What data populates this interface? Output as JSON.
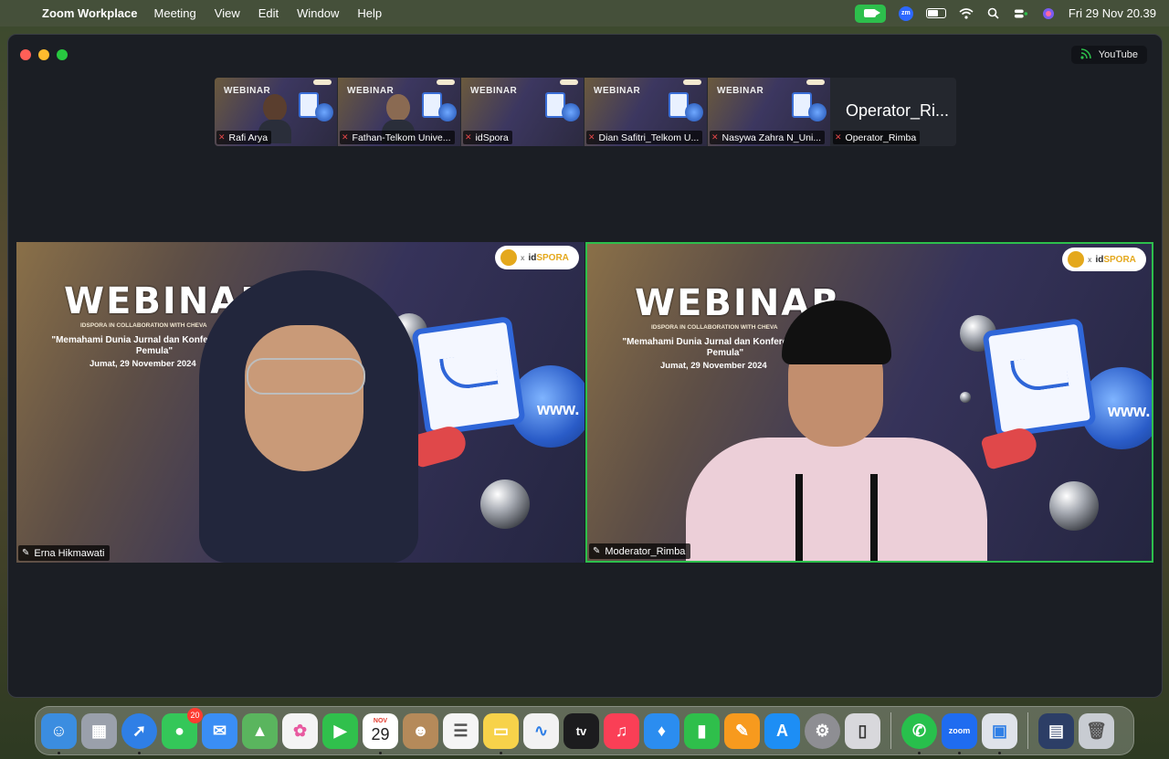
{
  "menubar": {
    "app_name": "Zoom Workplace",
    "menus": [
      "Meeting",
      "View",
      "Edit",
      "Window",
      "Help"
    ],
    "clock": "Fri 29 Nov  20.39",
    "zoom_badge": "zm"
  },
  "window": {
    "livestream_label": "YouTube"
  },
  "thumbnails": [
    {
      "name": "Rafi Arya",
      "slide_title": "WEBINAR"
    },
    {
      "name": "Fathan-Telkom Unive...",
      "slide_title": "WEBINAR"
    },
    {
      "name": "idSpora",
      "slide_title": "WEBINAR"
    },
    {
      "name": "Dian Safitri_Telkom U...",
      "slide_title": "WEBINAR"
    },
    {
      "name": "Nasywa Zahra N_Uni...",
      "slide_title": "WEBINAR"
    },
    {
      "name": "Operator_Rimba",
      "big_name": "Operator_Ri..."
    }
  ],
  "tiles": [
    {
      "name": "Erna Hikmawati",
      "title": "WEBINAR",
      "subtitle": "IDSPORA IN COLLABORATION WITH CHEVA",
      "quote": "\"Memahami Dunia Jurnal dan Konferensi untuk Pemula\"",
      "date": "Jumat, 29 November 2024",
      "logo_x": "x",
      "logo_ids": "id",
      "logo_spora": "SPORA",
      "globe_text": "www."
    },
    {
      "name": "Moderator_Rimba",
      "title": "WEBINAR",
      "subtitle": "IDSPORA IN COLLABORATION WITH CHEVA",
      "quote": "\"Memahami Dunia Jurnal dan Konferensi untuk Pemula\"",
      "date": "Jumat, 29 November 2024",
      "logo_x": "x",
      "logo_ids": "id",
      "logo_spora": "SPORA",
      "globe_text": "www."
    }
  ],
  "dock": {
    "messages_badge": "20",
    "calendar_month": "NOV",
    "calendar_day": "29",
    "tv_label": "tv",
    "zoom_label": "zoom",
    "apps": [
      {
        "icon": "finder-icon",
        "color": "#3b8de0"
      },
      {
        "icon": "launchpad-icon",
        "color": "#9aa0ab"
      },
      {
        "icon": "safari-icon",
        "color": "#2f7fe6"
      },
      {
        "icon": "messages-icon",
        "color": "#34c759"
      },
      {
        "icon": "mail-icon",
        "color": "#3a8ef5"
      },
      {
        "icon": "maps-icon",
        "color": "#5ab55e"
      },
      {
        "icon": "photos-icon",
        "color": "#f4f4f4"
      },
      {
        "icon": "facetime-icon",
        "color": "#30c04c"
      },
      {
        "icon": "calendar-icon",
        "color": "#ffffff"
      },
      {
        "icon": "contacts-icon",
        "color": "#b58a5a"
      },
      {
        "icon": "reminders-icon",
        "color": "#f5f5f5"
      },
      {
        "icon": "notes-icon",
        "color": "#f7d24a"
      },
      {
        "icon": "freeform-icon",
        "color": "#f2f2f2"
      },
      {
        "icon": "apple-tv-icon",
        "color": "#1c1c1e"
      },
      {
        "icon": "music-icon",
        "color": "#fa3f56"
      },
      {
        "icon": "keynote-icon",
        "color": "#2b8df0"
      },
      {
        "icon": "numbers-icon",
        "color": "#2fbf4b"
      },
      {
        "icon": "pages-icon",
        "color": "#f79a1e"
      },
      {
        "icon": "app-store-icon",
        "color": "#1d8ef5"
      },
      {
        "icon": "system-settings-icon",
        "color": "#8e8e93"
      },
      {
        "icon": "iphone-mirroring-icon",
        "color": "#d8d8dc"
      },
      {
        "icon": "whatsapp-icon",
        "color": "#28c04c"
      },
      {
        "icon": "zoom-icon",
        "color": "#1f6cf0"
      },
      {
        "icon": "preview-icon",
        "color": "#dfe3ea"
      },
      {
        "icon": "downloads-stack-icon",
        "color": "#2c3e66"
      },
      {
        "icon": "trash-icon",
        "color": "#c8ccd2"
      }
    ]
  }
}
